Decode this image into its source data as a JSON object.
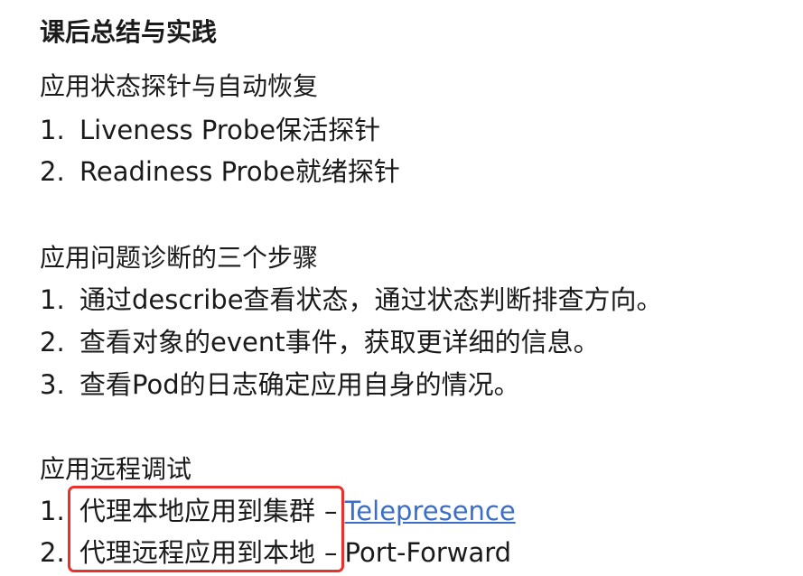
{
  "title": "课后总结与实践",
  "sections": [
    {
      "heading": "应用状态探针与自动恢复",
      "items": [
        {
          "num": "1.",
          "text": "Liveness Probe保活探针"
        },
        {
          "num": "2.",
          "text": "Readiness Probe就绪探针"
        }
      ]
    },
    {
      "heading": "应用问题诊断的三个步骤",
      "items": [
        {
          "num": "1.",
          "text": "通过describe查看状态，通过状态判断排查方向。"
        },
        {
          "num": "2.",
          "text": "查看对象的event事件，获取更详细的信息。"
        },
        {
          "num": "3.",
          "text": "查看Pod的日志确定应用自身的情况。"
        }
      ]
    },
    {
      "heading": "应用远程调试",
      "items": [
        {
          "num": "1.",
          "text": "代理本地应用到集群",
          "separator": "–",
          "suffix": "Telepresence"
        },
        {
          "num": "2.",
          "text": "代理远程应用到本地",
          "separator": "–",
          "suffix": "Port-Forward"
        }
      ]
    }
  ],
  "colors": {
    "text": "#1a1a1a",
    "link": "#3a6ec9",
    "highlight_box": "#e8302c"
  }
}
